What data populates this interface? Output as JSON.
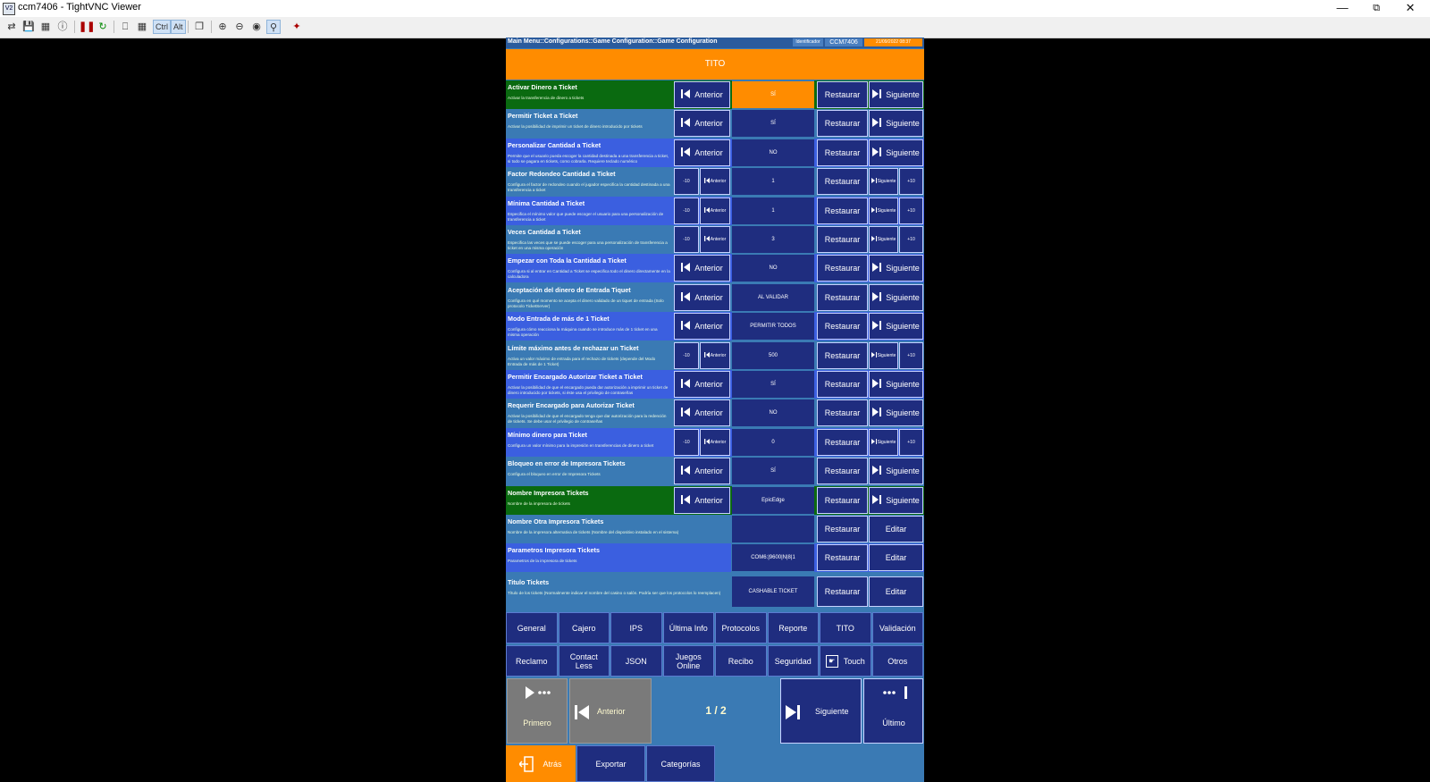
{
  "window": {
    "title": "ccm7406 - TightVNC Viewer",
    "app_icon": "V2",
    "controls": [
      "minimize-icon",
      "restore-icon",
      "close-icon"
    ]
  },
  "toolbar": {
    "ctrl_label": "Ctrl",
    "alt_label": "Alt"
  },
  "header": {
    "path": "Main Menu::Configurations::Game Configuration::Game Configuration",
    "identifier_label": "Identificador",
    "machine_id": "CCM7406",
    "datetime": "21/09/2022 08:37"
  },
  "section_title": "TITO",
  "labels": {
    "prev": "Anterior",
    "next": "Siguiente",
    "restore": "Restaurar",
    "edit": "Editar",
    "minus10": "-10",
    "plus10": "+10"
  },
  "settings": [
    {
      "title": "Activar Dinero a Ticket",
      "desc": "Activar la transferencia de dinero a tickets",
      "value": "SÍ"
    },
    {
      "title": "Permitir Ticket a Ticket",
      "desc": "Activar la posibilidad de imprimir un ticket de dinero introducido por tickets",
      "value": "SÍ"
    },
    {
      "title": "Personalizar Cantidad a Ticket",
      "desc": "Permite que el usuario pueda escoger la cantidad destinada a una transferencia a ticket, si todo se pagara en tickets, como cobrarla. Requiere teclado numérico",
      "value": "NO"
    },
    {
      "title": "Factor Redondeo Cantidad a Ticket",
      "desc": "Configura el factor de redondeo cuando el jugador especifica la cantidad destinada a una transferencia a ticket",
      "value": "1"
    },
    {
      "title": "Mínima Cantidad a Ticket",
      "desc": "Especifica el mínimo valor que puede escoger el usuario para una personalización de transferencia a ticket",
      "value": "1"
    },
    {
      "title": "Veces Cantidad a Ticket",
      "desc": "Especifica las veces que se puede escoger para una personalización de transferencia a ticket en una misma operación",
      "value": "3"
    },
    {
      "title": "Empezar con Toda la Cantidad a Ticket",
      "desc": "Configura si al entrar en Cantidad a Ticket se especifica todo el dinero directamente en la calculadora",
      "value": "NO"
    },
    {
      "title": "Aceptación del dinero de Entrada Tiquet",
      "desc": "Configura en qué momento se acepta el dinero validado de un tiquet de entrada (Solo protocolo TicketServer)",
      "value": "AL VALIDAR"
    },
    {
      "title": "Modo Entrada de más de 1 Ticket",
      "desc": "Configura cómo reacciona la máquina cuando se introduce más de 1 ticket en una misma operación",
      "value": "PERMITIR TODOS"
    },
    {
      "title": "Límite máximo antes de rechazar un Ticket",
      "desc": "Activa un valor máximo de entrada para el rechazo de tickets (depende del Modo Entrada de más de 1 Ticket)",
      "value": "500"
    },
    {
      "title": "Permitir Encargado Autorizar Ticket a Ticket",
      "desc": "Activar la posibilidad de que el encargado pueda dar autorización a imprimir un ticket de dinero introducido por tickets, si éste usa el privilegio de contraseñas",
      "value": "SÍ"
    },
    {
      "title": "Requerir Encargado para Autorizar Ticket",
      "desc": "Activar la posibilidad de que el encargado tenga que dar autorización para la redención de tickets. Se debe usar el privilegio de contraseñas",
      "value": "NO"
    },
    {
      "title": "Mínimo dinero para Ticket",
      "desc": "Configura un valor mínimo para la impresión en transferencias de dinero a ticket",
      "value": "0"
    },
    {
      "title": "Bloqueo en error de Impresora Tickets",
      "desc": "Configura el bloqueo en error de Impresora Tickets",
      "value": "SÍ"
    },
    {
      "title": "Nombre Impresora Tickets",
      "desc": "Nombre de la impresora de tickets",
      "value": "EpicEdge"
    },
    {
      "title": "Nombre Otra Impresora Tickets",
      "desc": "Nombre de la impresora alternativa de tickets (Nombre del dispositivo instalado en el sistema)",
      "value": ""
    },
    {
      "title": "Parametros Impresora Tickets",
      "desc": "Parametros de la impresora de tickets",
      "value": "COM6:|9600|N|8|1"
    },
    {
      "title": "Titulo Tickets",
      "desc": "Título de los tickets (Normalmente indicar el nombre del casino o salón. Podría ser que los protocolos lo reemplacen)",
      "value": "CASHABLE TICKET"
    }
  ],
  "categories_row1": [
    "General",
    "Cajero",
    "IPS",
    "Última Info",
    "Protocolos",
    "Reporte",
    "TITO",
    "Validación"
  ],
  "categories_row2": [
    "Reclamo",
    "Contact Less",
    "JSON",
    "Juegos Online",
    "Recibo",
    "Seguridad",
    "Touch",
    "Otros"
  ],
  "pager": {
    "first": "Primero",
    "prev": "Anterior",
    "page": "1 / 2",
    "next": "Siguiente",
    "last": "Último"
  },
  "footer": {
    "back": "Atrás",
    "export": "Exportar",
    "categories": "Categorías"
  },
  "colors": {
    "orange": "#ff8c00",
    "navy": "#1f2d7f",
    "green": "#0a6a10",
    "blue": "#3b5fe0",
    "steel": "#3a7ab4"
  }
}
